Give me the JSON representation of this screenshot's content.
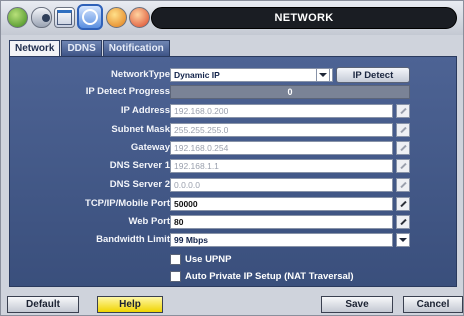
{
  "window": {
    "title": "NETWORK"
  },
  "toolbar": {
    "icons": [
      "gear-icon",
      "toggle-icon",
      "calendar-icon",
      "network-icon",
      "clock-icon",
      "notification-icon"
    ]
  },
  "tabs": [
    {
      "label": "Network",
      "active": true
    },
    {
      "label": "DDNS",
      "active": false
    },
    {
      "label": "Notification",
      "active": false
    }
  ],
  "network": {
    "network_type": {
      "label": "NetworkType",
      "value": "Dynamic IP"
    },
    "ip_detect_button": "IP Detect",
    "ip_detect_progress": {
      "label": "IP Detect Progress",
      "value": "0"
    },
    "ip_address": {
      "label": "IP Address",
      "value": "192.168.0.200"
    },
    "subnet_mask": {
      "label": "Subnet Mask",
      "value": "255.255.255.0"
    },
    "gateway": {
      "label": "Gateway",
      "value": "192.168.0.254"
    },
    "dns_server_1": {
      "label": "DNS Server 1",
      "value": "192.168.1.1"
    },
    "dns_server_2": {
      "label": "DNS Server 2",
      "value": "0.0.0.0"
    },
    "tcp_port": {
      "label": "TCP/IP/Mobile Port",
      "value": "50000"
    },
    "web_port": {
      "label": "Web Port",
      "value": "80"
    },
    "bandwidth_limit": {
      "label": "Bandwidth Limit",
      "value": "99 Mbps"
    },
    "use_upnp": {
      "label": "Use UPNP",
      "checked": false
    },
    "auto_private_ip": {
      "label": "Auto Private IP Setup (NAT Traversal)",
      "checked": false
    }
  },
  "footer": {
    "default_label": "Default",
    "help_label": "Help",
    "save_label": "Save",
    "cancel_label": "Cancel"
  },
  "colors": {
    "panel": "#445a8a",
    "title_bar": "#1a1d23",
    "help_button": "#f0d400"
  }
}
